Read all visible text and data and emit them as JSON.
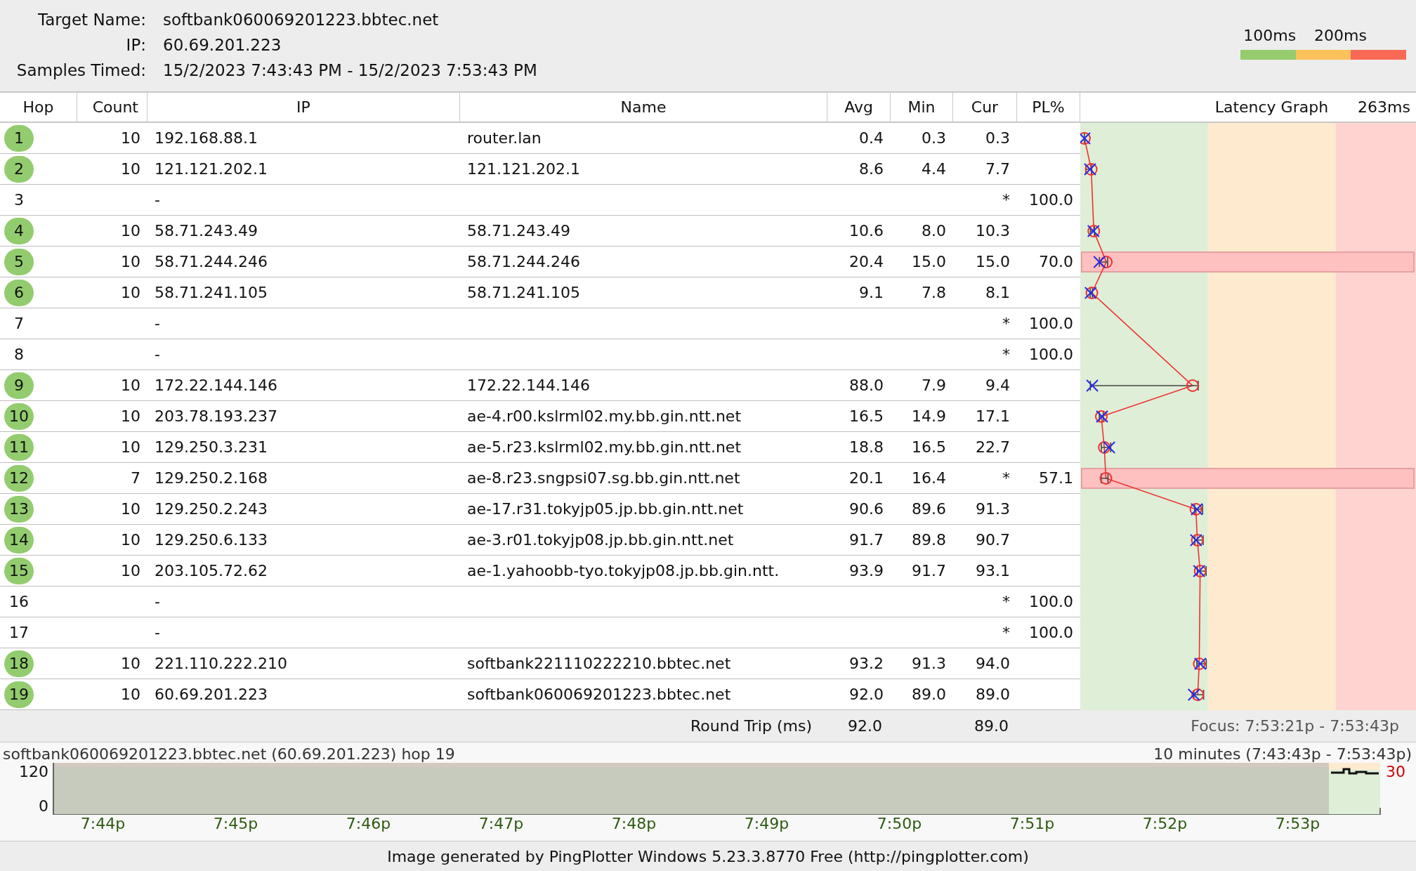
{
  "header": {
    "fields": [
      {
        "label": "Target Name:",
        "value": "softbank060069201223.bbtec.net"
      },
      {
        "label": "IP:",
        "value": "60.69.201.223"
      },
      {
        "label": "Samples Timed:",
        "value": "15/2/2023 7:43:43 PM - 15/2/2023 7:53:43 PM"
      }
    ],
    "legend": [
      "100ms",
      "200ms"
    ]
  },
  "table": {
    "columns": [
      "Hop",
      "Count",
      "IP",
      "Name",
      "Avg",
      "Min",
      "Cur",
      "PL%",
      "Latency Graph",
      "263ms"
    ],
    "rows": [
      {
        "hop": "1",
        "count": "10",
        "ip": "192.168.88.1",
        "name": "router.lan",
        "avg": "0.4",
        "min": "0.3",
        "cur": "0.3",
        "responded": true
      },
      {
        "hop": "2",
        "count": "10",
        "ip": "121.121.202.1",
        "name": "121.121.202.1",
        "avg": "8.6",
        "min": "4.4",
        "cur": "7.7",
        "responded": true
      },
      {
        "hop": "3",
        "ip": "-",
        "cur": "*",
        "pl": "100.0",
        "responded": false
      },
      {
        "hop": "4",
        "count": "10",
        "ip": "58.71.243.49",
        "name": "58.71.243.49",
        "avg": "10.6",
        "min": "8.0",
        "cur": "10.3",
        "responded": true
      },
      {
        "hop": "5",
        "count": "10",
        "ip": "58.71.244.246",
        "name": "58.71.244.246",
        "avg": "20.4",
        "min": "15.0",
        "cur": "15.0",
        "pl": "70.0",
        "responded": true
      },
      {
        "hop": "6",
        "count": "10",
        "ip": "58.71.241.105",
        "name": "58.71.241.105",
        "avg": "9.1",
        "min": "7.8",
        "cur": "8.1",
        "responded": true
      },
      {
        "hop": "7",
        "ip": "-",
        "cur": "*",
        "pl": "100.0",
        "responded": false
      },
      {
        "hop": "8",
        "ip": "-",
        "cur": "*",
        "pl": "100.0",
        "responded": false
      },
      {
        "hop": "9",
        "count": "10",
        "ip": "172.22.144.146",
        "name": "172.22.144.146",
        "avg": "88.0",
        "min": "7.9",
        "cur": "9.4",
        "responded": true
      },
      {
        "hop": "10",
        "count": "10",
        "ip": "203.78.193.237",
        "name": "ae-4.r00.kslrml02.my.bb.gin.ntt.net",
        "avg": "16.5",
        "min": "14.9",
        "cur": "17.1",
        "responded": true
      },
      {
        "hop": "11",
        "count": "10",
        "ip": "129.250.3.231",
        "name": "ae-5.r23.kslrml02.my.bb.gin.ntt.net",
        "avg": "18.8",
        "min": "16.5",
        "cur": "22.7",
        "responded": true
      },
      {
        "hop": "12",
        "count": "7",
        "ip": "129.250.2.168",
        "name": "ae-8.r23.sngpsi07.sg.bb.gin.ntt.net",
        "avg": "20.1",
        "min": "16.4",
        "cur": "*",
        "pl": "57.1",
        "responded": true
      },
      {
        "hop": "13",
        "count": "10",
        "ip": "129.250.2.243",
        "name": "ae-17.r31.tokyjp05.jp.bb.gin.ntt.net",
        "avg": "90.6",
        "min": "89.6",
        "cur": "91.3",
        "responded": true
      },
      {
        "hop": "14",
        "count": "10",
        "ip": "129.250.6.133",
        "name": "ae-3.r01.tokyjp08.jp.bb.gin.ntt.net",
        "avg": "91.7",
        "min": "89.8",
        "cur": "90.7",
        "responded": true
      },
      {
        "hop": "15",
        "count": "10",
        "ip": "203.105.72.62",
        "name": "ae-1.yahoobb-tyo.tokyjp08.jp.bb.gin.ntt.",
        "avg": "93.9",
        "min": "91.7",
        "cur": "93.1",
        "responded": true
      },
      {
        "hop": "16",
        "ip": "-",
        "cur": "*",
        "pl": "100.0",
        "responded": false
      },
      {
        "hop": "17",
        "ip": "-",
        "cur": "*",
        "pl": "100.0",
        "responded": false
      },
      {
        "hop": "18",
        "count": "10",
        "ip": "221.110.222.210",
        "name": "softbank221110222210.bbtec.net",
        "avg": "93.2",
        "min": "91.3",
        "cur": "94.0",
        "responded": true
      },
      {
        "hop": "19",
        "count": "10",
        "ip": "60.69.201.223",
        "name": "softbank060069201223.bbtec.net",
        "avg": "92.0",
        "min": "89.0",
        "cur": "89.0",
        "responded": true
      }
    ],
    "round_trip": {
      "label": "Round Trip (ms)",
      "avg": "92.0",
      "cur": "89.0",
      "focus": "Focus: 7:53:21p - 7:53:43p"
    }
  },
  "timeline": {
    "target": "softbank060069201223.bbtec.net (60.69.201.223) hop 19",
    "range": "10 minutes (7:43:43p - 7:53:43p)",
    "yticks": [
      "120",
      "0"
    ],
    "current": "30",
    "xticks": [
      "7:44p",
      "7:45p",
      "7:46p",
      "7:47p",
      "7:48p",
      "7:49p",
      "7:50p",
      "7:51p",
      "7:52p",
      "7:53p"
    ]
  },
  "footer": "Image generated by PingPlotter Windows 5.23.3.8770 Free (http://pingplotter.com)"
}
